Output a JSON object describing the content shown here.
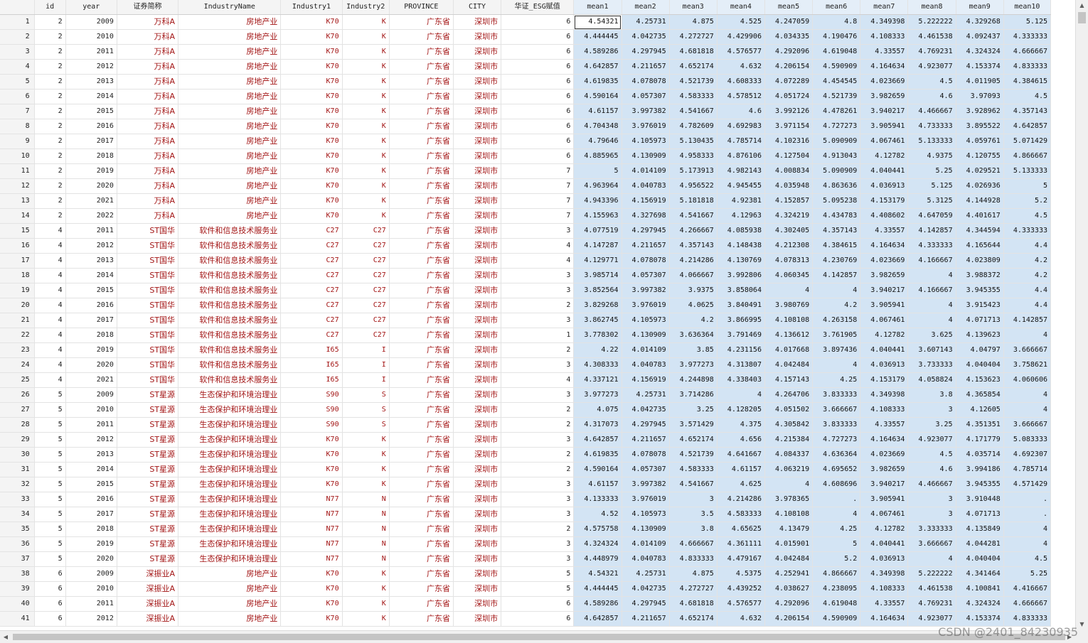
{
  "columns": [
    "id",
    "year",
    "证券简称",
    "IndustryName",
    "Industry1",
    "Industry2",
    "PROVINCE",
    "CITY",
    "华证_ESG赋值",
    "mean1",
    "mean2",
    "mean3",
    "mean4",
    "mean5",
    "mean6",
    "mean7",
    "mean8",
    "mean9",
    "mean10"
  ],
  "rows": [
    {
      "n": "1",
      "c": [
        "2",
        "2009",
        "万科A",
        "房地产业",
        "K70",
        "K",
        "广东省",
        "深圳市",
        "6",
        "4.54321",
        "4.25731",
        "4.875",
        "4.525",
        "4.247059",
        "4.8",
        "4.349398",
        "5.222222",
        "4.329268",
        "5.125"
      ]
    },
    {
      "n": "2",
      "c": [
        "2",
        "2010",
        "万科A",
        "房地产业",
        "K70",
        "K",
        "广东省",
        "深圳市",
        "6",
        "4.444445",
        "4.042735",
        "4.272727",
        "4.429906",
        "4.034335",
        "4.190476",
        "4.108333",
        "4.461538",
        "4.092437",
        "4.333333"
      ]
    },
    {
      "n": "3",
      "c": [
        "2",
        "2011",
        "万科A",
        "房地产业",
        "K70",
        "K",
        "广东省",
        "深圳市",
        "6",
        "4.589286",
        "4.297945",
        "4.681818",
        "4.576577",
        "4.292096",
        "4.619048",
        "4.33557",
        "4.769231",
        "4.324324",
        "4.666667"
      ]
    },
    {
      "n": "4",
      "c": [
        "2",
        "2012",
        "万科A",
        "房地产业",
        "K70",
        "K",
        "广东省",
        "深圳市",
        "6",
        "4.642857",
        "4.211657",
        "4.652174",
        "4.632",
        "4.206154",
        "4.590909",
        "4.164634",
        "4.923077",
        "4.153374",
        "4.833333"
      ]
    },
    {
      "n": "5",
      "c": [
        "2",
        "2013",
        "万科A",
        "房地产业",
        "K70",
        "K",
        "广东省",
        "深圳市",
        "6",
        "4.619835",
        "4.078078",
        "4.521739",
        "4.608333",
        "4.072289",
        "4.454545",
        "4.023669",
        "4.5",
        "4.011905",
        "4.384615"
      ]
    },
    {
      "n": "6",
      "c": [
        "2",
        "2014",
        "万科A",
        "房地产业",
        "K70",
        "K",
        "广东省",
        "深圳市",
        "6",
        "4.590164",
        "4.057307",
        "4.583333",
        "4.578512",
        "4.051724",
        "4.521739",
        "3.982659",
        "4.6",
        "3.97093",
        "4.5"
      ]
    },
    {
      "n": "7",
      "c": [
        "2",
        "2015",
        "万科A",
        "房地产业",
        "K70",
        "K",
        "广东省",
        "深圳市",
        "6",
        "4.61157",
        "3.997382",
        "4.541667",
        "4.6",
        "3.992126",
        "4.478261",
        "3.940217",
        "4.466667",
        "3.928962",
        "4.357143"
      ]
    },
    {
      "n": "8",
      "c": [
        "2",
        "2016",
        "万科A",
        "房地产业",
        "K70",
        "K",
        "广东省",
        "深圳市",
        "6",
        "4.704348",
        "3.976019",
        "4.782609",
        "4.692983",
        "3.971154",
        "4.727273",
        "3.905941",
        "4.733333",
        "3.895522",
        "4.642857"
      ]
    },
    {
      "n": "9",
      "c": [
        "2",
        "2017",
        "万科A",
        "房地产业",
        "K70",
        "K",
        "广东省",
        "深圳市",
        "6",
        "4.79646",
        "4.105973",
        "5.130435",
        "4.785714",
        "4.102316",
        "5.090909",
        "4.067461",
        "5.133333",
        "4.059761",
        "5.071429"
      ]
    },
    {
      "n": "10",
      "c": [
        "2",
        "2018",
        "万科A",
        "房地产业",
        "K70",
        "K",
        "广东省",
        "深圳市",
        "6",
        "4.885965",
        "4.130909",
        "4.958333",
        "4.876106",
        "4.127504",
        "4.913043",
        "4.12782",
        "4.9375",
        "4.120755",
        "4.866667"
      ]
    },
    {
      "n": "11",
      "c": [
        "2",
        "2019",
        "万科A",
        "房地产业",
        "K70",
        "K",
        "广东省",
        "深圳市",
        "7",
        "5",
        "4.014109",
        "5.173913",
        "4.982143",
        "4.008834",
        "5.090909",
        "4.040441",
        "5.25",
        "4.029521",
        "5.133333"
      ]
    },
    {
      "n": "12",
      "c": [
        "2",
        "2020",
        "万科A",
        "房地产业",
        "K70",
        "K",
        "广东省",
        "深圳市",
        "7",
        "4.963964",
        "4.040783",
        "4.956522",
        "4.945455",
        "4.035948",
        "4.863636",
        "4.036913",
        "5.125",
        "4.026936",
        "5"
      ]
    },
    {
      "n": "13",
      "c": [
        "2",
        "2021",
        "万科A",
        "房地产业",
        "K70",
        "K",
        "广东省",
        "深圳市",
        "7",
        "4.943396",
        "4.156919",
        "5.181818",
        "4.92381",
        "4.152857",
        "5.095238",
        "4.153179",
        "5.3125",
        "4.144928",
        "5.2"
      ]
    },
    {
      "n": "14",
      "c": [
        "2",
        "2022",
        "万科A",
        "房地产业",
        "K70",
        "K",
        "广东省",
        "深圳市",
        "7",
        "4.155963",
        "4.327698",
        "4.541667",
        "4.12963",
        "4.324219",
        "4.434783",
        "4.408602",
        "4.647059",
        "4.401617",
        "4.5"
      ]
    },
    {
      "n": "15",
      "c": [
        "4",
        "2011",
        "ST国华",
        "软件和信息技术服务业",
        "C27",
        "C27",
        "广东省",
        "深圳市",
        "3",
        "4.077519",
        "4.297945",
        "4.266667",
        "4.085938",
        "4.302405",
        "4.357143",
        "4.33557",
        "4.142857",
        "4.344594",
        "4.333333"
      ]
    },
    {
      "n": "16",
      "c": [
        "4",
        "2012",
        "ST国华",
        "软件和信息技术服务业",
        "C27",
        "C27",
        "广东省",
        "深圳市",
        "4",
        "4.147287",
        "4.211657",
        "4.357143",
        "4.148438",
        "4.212308",
        "4.384615",
        "4.164634",
        "4.333333",
        "4.165644",
        "4.4"
      ]
    },
    {
      "n": "17",
      "c": [
        "4",
        "2013",
        "ST国华",
        "软件和信息技术服务业",
        "C27",
        "C27",
        "广东省",
        "深圳市",
        "4",
        "4.129771",
        "4.078078",
        "4.214286",
        "4.130769",
        "4.078313",
        "4.230769",
        "4.023669",
        "4.166667",
        "4.023809",
        "4.2"
      ]
    },
    {
      "n": "18",
      "c": [
        "4",
        "2014",
        "ST国华",
        "软件和信息技术服务业",
        "C27",
        "C27",
        "广东省",
        "深圳市",
        "3",
        "3.985714",
        "4.057307",
        "4.066667",
        "3.992806",
        "4.060345",
        "4.142857",
        "3.982659",
        "4",
        "3.988372",
        "4.2"
      ]
    },
    {
      "n": "19",
      "c": [
        "4",
        "2015",
        "ST国华",
        "软件和信息技术服务业",
        "C27",
        "C27",
        "广东省",
        "深圳市",
        "3",
        "3.852564",
        "3.997382",
        "3.9375",
        "3.858064",
        "4",
        "4",
        "3.940217",
        "4.166667",
        "3.945355",
        "4.4"
      ]
    },
    {
      "n": "20",
      "c": [
        "4",
        "2016",
        "ST国华",
        "软件和信息技术服务业",
        "C27",
        "C27",
        "广东省",
        "深圳市",
        "2",
        "3.829268",
        "3.976019",
        "4.0625",
        "3.840491",
        "3.980769",
        "4.2",
        "3.905941",
        "4",
        "3.915423",
        "4.4"
      ]
    },
    {
      "n": "21",
      "c": [
        "4",
        "2017",
        "ST国华",
        "软件和信息技术服务业",
        "C27",
        "C27",
        "广东省",
        "深圳市",
        "3",
        "3.862745",
        "4.105973",
        "4.2",
        "3.866995",
        "4.108108",
        "4.263158",
        "4.067461",
        "4",
        "4.071713",
        "4.142857"
      ]
    },
    {
      "n": "22",
      "c": [
        "4",
        "2018",
        "ST国华",
        "软件和信息技术服务业",
        "C27",
        "C27",
        "广东省",
        "深圳市",
        "1",
        "3.778302",
        "4.130909",
        "3.636364",
        "3.791469",
        "4.136612",
        "3.761905",
        "4.12782",
        "3.625",
        "4.139623",
        "4"
      ]
    },
    {
      "n": "23",
      "c": [
        "4",
        "2019",
        "ST国华",
        "软件和信息技术服务业",
        "I65",
        "I",
        "广东省",
        "深圳市",
        "2",
        "4.22",
        "4.014109",
        "3.85",
        "4.231156",
        "4.017668",
        "3.897436",
        "4.040441",
        "3.607143",
        "4.04797",
        "3.666667"
      ]
    },
    {
      "n": "24",
      "c": [
        "4",
        "2020",
        "ST国华",
        "软件和信息技术服务业",
        "I65",
        "I",
        "广东省",
        "深圳市",
        "3",
        "4.308333",
        "4.040783",
        "3.977273",
        "4.313807",
        "4.042484",
        "4",
        "4.036913",
        "3.733333",
        "4.040404",
        "3.758621"
      ]
    },
    {
      "n": "25",
      "c": [
        "4",
        "2021",
        "ST国华",
        "软件和信息技术服务业",
        "I65",
        "I",
        "广东省",
        "深圳市",
        "4",
        "4.337121",
        "4.156919",
        "4.244898",
        "4.338403",
        "4.157143",
        "4.25",
        "4.153179",
        "4.058824",
        "4.153623",
        "4.060606"
      ]
    },
    {
      "n": "26",
      "c": [
        "5",
        "2009",
        "ST星源",
        "生态保护和环境治理业",
        "S90",
        "S",
        "广东省",
        "深圳市",
        "3",
        "3.977273",
        "4.25731",
        "3.714286",
        "4",
        "4.264706",
        "3.833333",
        "4.349398",
        "3.8",
        "4.365854",
        "4"
      ]
    },
    {
      "n": "27",
      "c": [
        "5",
        "2010",
        "ST星源",
        "生态保护和环境治理业",
        "S90",
        "S",
        "广东省",
        "深圳市",
        "2",
        "4.075",
        "4.042735",
        "3.25",
        "4.128205",
        "4.051502",
        "3.666667",
        "4.108333",
        "3",
        "4.12605",
        "4"
      ]
    },
    {
      "n": "28",
      "c": [
        "5",
        "2011",
        "ST星源",
        "生态保护和环境治理业",
        "S90",
        "S",
        "广东省",
        "深圳市",
        "2",
        "4.317073",
        "4.297945",
        "3.571429",
        "4.375",
        "4.305842",
        "3.833333",
        "4.33557",
        "3.25",
        "4.351351",
        "3.666667"
      ]
    },
    {
      "n": "29",
      "c": [
        "5",
        "2012",
        "ST星源",
        "生态保护和环境治理业",
        "K70",
        "K",
        "广东省",
        "深圳市",
        "3",
        "4.642857",
        "4.211657",
        "4.652174",
        "4.656",
        "4.215384",
        "4.727273",
        "4.164634",
        "4.923077",
        "4.171779",
        "5.083333"
      ]
    },
    {
      "n": "30",
      "c": [
        "5",
        "2013",
        "ST星源",
        "生态保护和环境治理业",
        "K70",
        "K",
        "广东省",
        "深圳市",
        "2",
        "4.619835",
        "4.078078",
        "4.521739",
        "4.641667",
        "4.084337",
        "4.636364",
        "4.023669",
        "4.5",
        "4.035714",
        "4.692307"
      ]
    },
    {
      "n": "31",
      "c": [
        "5",
        "2014",
        "ST星源",
        "生态保护和环境治理业",
        "K70",
        "K",
        "广东省",
        "深圳市",
        "2",
        "4.590164",
        "4.057307",
        "4.583333",
        "4.61157",
        "4.063219",
        "4.695652",
        "3.982659",
        "4.6",
        "3.994186",
        "4.785714"
      ]
    },
    {
      "n": "32",
      "c": [
        "5",
        "2015",
        "ST星源",
        "生态保护和环境治理业",
        "K70",
        "K",
        "广东省",
        "深圳市",
        "3",
        "4.61157",
        "3.997382",
        "4.541667",
        "4.625",
        "4",
        "4.608696",
        "3.940217",
        "4.466667",
        "3.945355",
        "4.571429"
      ]
    },
    {
      "n": "33",
      "c": [
        "5",
        "2016",
        "ST星源",
        "生态保护和环境治理业",
        "N77",
        "N",
        "广东省",
        "深圳市",
        "3",
        "4.133333",
        "3.976019",
        "3",
        "4.214286",
        "3.978365",
        ".",
        "3.905941",
        "3",
        "3.910448",
        "."
      ]
    },
    {
      "n": "34",
      "c": [
        "5",
        "2017",
        "ST星源",
        "生态保护和环境治理业",
        "N77",
        "N",
        "广东省",
        "深圳市",
        "3",
        "4.52",
        "4.105973",
        "3.5",
        "4.583333",
        "4.108108",
        "4",
        "4.067461",
        "3",
        "4.071713",
        "."
      ]
    },
    {
      "n": "35",
      "c": [
        "5",
        "2018",
        "ST星源",
        "生态保护和环境治理业",
        "N77",
        "N",
        "广东省",
        "深圳市",
        "2",
        "4.575758",
        "4.130909",
        "3.8",
        "4.65625",
        "4.13479",
        "4.25",
        "4.12782",
        "3.333333",
        "4.135849",
        "4"
      ]
    },
    {
      "n": "36",
      "c": [
        "5",
        "2019",
        "ST星源",
        "生态保护和环境治理业",
        "N77",
        "N",
        "广东省",
        "深圳市",
        "3",
        "4.324324",
        "4.014109",
        "4.666667",
        "4.361111",
        "4.015901",
        "5",
        "4.040441",
        "3.666667",
        "4.044281",
        "4"
      ]
    },
    {
      "n": "37",
      "c": [
        "5",
        "2020",
        "ST星源",
        "生态保护和环境治理业",
        "N77",
        "N",
        "广东省",
        "深圳市",
        "3",
        "4.448979",
        "4.040783",
        "4.833333",
        "4.479167",
        "4.042484",
        "5.2",
        "4.036913",
        "4",
        "4.040404",
        "4.5"
      ]
    },
    {
      "n": "38",
      "c": [
        "6",
        "2009",
        "深振业A",
        "房地产业",
        "K70",
        "K",
        "广东省",
        "深圳市",
        "5",
        "4.54321",
        "4.25731",
        "4.875",
        "4.5375",
        "4.252941",
        "4.866667",
        "4.349398",
        "5.222222",
        "4.341464",
        "5.25"
      ]
    },
    {
      "n": "39",
      "c": [
        "6",
        "2010",
        "深振业A",
        "房地产业",
        "K70",
        "K",
        "广东省",
        "深圳市",
        "5",
        "4.444445",
        "4.042735",
        "4.272727",
        "4.439252",
        "4.038627",
        "4.238095",
        "4.108333",
        "4.461538",
        "4.100841",
        "4.416667"
      ]
    },
    {
      "n": "40",
      "c": [
        "6",
        "2011",
        "深振业A",
        "房地产业",
        "K70",
        "K",
        "广东省",
        "深圳市",
        "6",
        "4.589286",
        "4.297945",
        "4.681818",
        "4.576577",
        "4.292096",
        "4.619048",
        "4.33557",
        "4.769231",
        "4.324324",
        "4.666667"
      ]
    },
    {
      "n": "41",
      "c": [
        "6",
        "2012",
        "深振业A",
        "房地产业",
        "K70",
        "K",
        "广东省",
        "深圳市",
        "6",
        "4.642857",
        "4.211657",
        "4.652174",
        "4.632",
        "4.206154",
        "4.590909",
        "4.164634",
        "4.923077",
        "4.153374",
        "4.833333"
      ]
    }
  ],
  "watermark": "CSDN @2401_84230935",
  "icons": {
    "up": "up-arrow-icon",
    "down": "down-arrow-icon",
    "left": "left-arrow-icon",
    "right": "right-arrow-icon"
  },
  "colors": {
    "string_text": "#a31515",
    "mean_bg": "#d3e4f4",
    "header_bg": "#f4f4f4"
  }
}
